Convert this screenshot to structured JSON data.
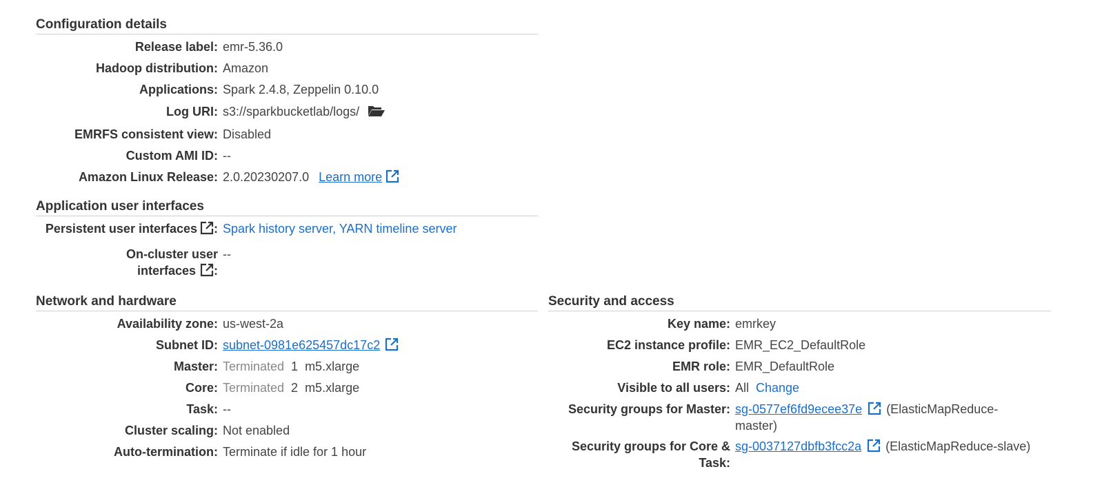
{
  "configuration": {
    "title": "Configuration details",
    "release_label": {
      "label": "Release label:",
      "value": "emr-5.36.0"
    },
    "hadoop": {
      "label": "Hadoop distribution:",
      "value": "Amazon"
    },
    "applications": {
      "label": "Applications:",
      "value": "Spark 2.4.8, Zeppelin 0.10.0"
    },
    "log_uri": {
      "label": "Log URI:",
      "value": "s3://sparkbucketlab/logs/",
      "icon": "folder-open-icon"
    },
    "emrfs": {
      "label": "EMRFS consistent view:",
      "value": "Disabled"
    },
    "custom_ami": {
      "label": "Custom AMI ID:",
      "value": "--"
    },
    "amazon_linux": {
      "label": "Amazon Linux Release:",
      "value": "2.0.20230207.0",
      "link": "Learn more"
    }
  },
  "app_ui": {
    "title": "Application user interfaces",
    "persistent": {
      "label": "Persistent user interfaces",
      "colon": ":",
      "link1": "Spark history server",
      "sep": ", ",
      "link2": "YARN timeline server"
    },
    "on_cluster": {
      "label_line1": "On-cluster user",
      "label_line2": "interfaces",
      "colon": ":",
      "value": "--"
    }
  },
  "network": {
    "title": "Network and hardware",
    "az": {
      "label": "Availability zone:",
      "value": "us-west-2a"
    },
    "subnet": {
      "label": "Subnet ID:",
      "value": "subnet-0981e625457dc17c2"
    },
    "master": {
      "label": "Master:",
      "status": "Terminated",
      "count": "1",
      "type": "m5.xlarge"
    },
    "core": {
      "label": "Core:",
      "status": "Terminated",
      "count": "2",
      "type": "m5.xlarge"
    },
    "task": {
      "label": "Task:",
      "value": "--"
    },
    "scaling": {
      "label": "Cluster scaling:",
      "value": "Not enabled"
    },
    "autoterm": {
      "label": "Auto-termination:",
      "value": "Terminate if idle for 1 hour"
    }
  },
  "security": {
    "title": "Security and access",
    "key": {
      "label": "Key name:",
      "value": "emrkey"
    },
    "ec2_profile": {
      "label": "EC2 instance profile:",
      "value": "EMR_EC2_DefaultRole"
    },
    "emr_role": {
      "label": "EMR role:",
      "value": "EMR_DefaultRole"
    },
    "visible": {
      "label": "Visible to all users:",
      "value": "All",
      "link": "Change"
    },
    "sg_master": {
      "label": "Security groups for Master:",
      "value": "sg-0577ef6fd9ecee37e",
      "suffix_line1": "(ElasticMapReduce-",
      "suffix_line2": "master)"
    },
    "sg_core": {
      "label_line1": "Security groups for Core &",
      "label_line2": "Task:",
      "value": "sg-0037127dbfb3fcc2a",
      "suffix": "(ElasticMapReduce-slave)"
    }
  },
  "colors": {
    "link": "#1a6fc9",
    "muted": "#888888",
    "text": "#333333",
    "divider": "#cfcfcf"
  }
}
